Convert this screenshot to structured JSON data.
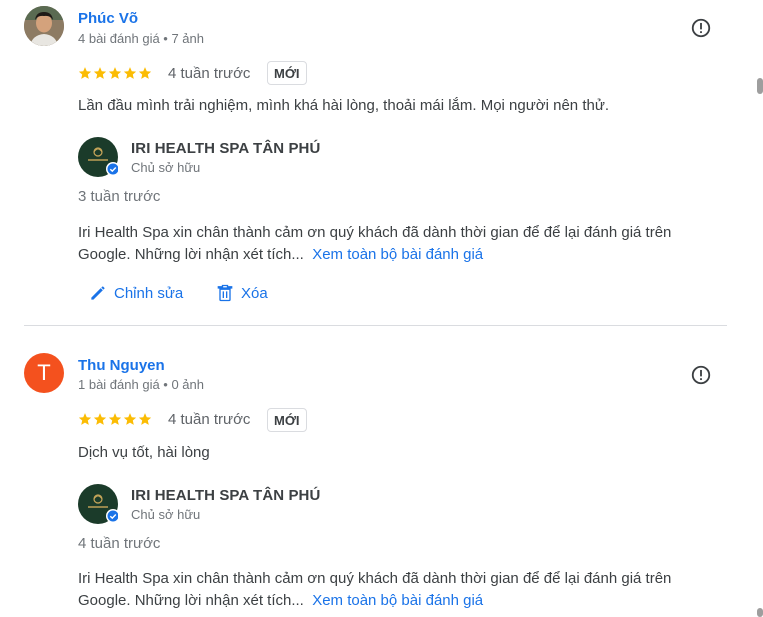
{
  "reviews": [
    {
      "reviewer": "Phúc Võ",
      "reviewer_meta": "4 bài đánh giá • 7 ảnh",
      "rating": 5,
      "time": "4 tuần trước",
      "badge": "MỚI",
      "text": "Lần đầu mình trải nghiệm, mình khá hài lòng, thoải mái lắm. Mọi người nên thử.",
      "owner_response": {
        "owner_name": "IRI HEALTH SPA TÂN PHÚ",
        "owner_role": "Chủ sở hữu",
        "time": "3 tuần trước",
        "text": "Iri Health Spa xin chân thành cảm ơn quý khách đã dành thời gian để để lại đánh giá trên Google. Những lời nhận xét tích...",
        "see_more": "Xem toàn bộ bài đánh giá"
      },
      "actions": {
        "edit": "Chỉnh sửa",
        "delete": "Xóa"
      }
    },
    {
      "reviewer": "Thu Nguyen",
      "reviewer_initial": "T",
      "reviewer_meta": "1 bài đánh giá • 0 ảnh",
      "rating": 5,
      "time": "4 tuần trước",
      "badge": "MỚI",
      "text": "Dịch vụ tốt, hài lòng",
      "owner_response": {
        "owner_name": "IRI HEALTH SPA TÂN PHÚ",
        "owner_role": "Chủ sở hữu",
        "time": "4 tuần trước",
        "text": "Iri Health Spa xin chân thành cảm ơn quý khách đã dành thời gian để để lại đánh giá trên Google. Những lời nhận xét tích...",
        "see_more": "Xem toàn bộ bài đánh giá"
      }
    }
  ],
  "colors": {
    "link": "#1a73e8",
    "star": "#fbbc04",
    "avatar_t": "#f4511e",
    "verified": "#1a73e8",
    "logo_bg": "#1b3b2a"
  },
  "icons": [
    "flag-icon",
    "star-icon",
    "pencil-icon",
    "trash-icon",
    "verified-check-icon",
    "spa-logo"
  ]
}
